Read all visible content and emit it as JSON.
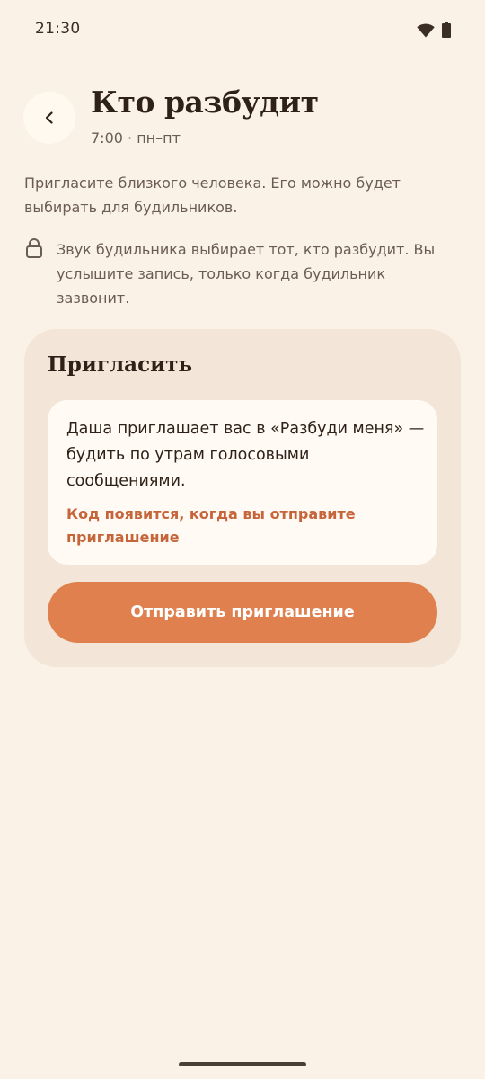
{
  "status_bar": {
    "time": "21:30",
    "icons": [
      "wifi-icon",
      "battery-icon"
    ]
  },
  "header": {
    "back_icon": "chevron-left-icon",
    "title": "Кто разбудит",
    "subtitle": "7:00 · пн–пт"
  },
  "intro": {
    "text": "Пригласите близкого человека. Его можно будет выбирать для будильников."
  },
  "privacy": {
    "icon": "lock-icon",
    "text": "Звук будильника выбирает тот, кто разбудит. Вы услышите запись, только когда будильник зазвонит."
  },
  "invite": {
    "title": "Пригласить",
    "message": "Даша приглашает вас в «Разбуди меня» — будить по утрам голосовыми сообщениями.",
    "code_hint": "Код появится, когда вы отправите приглашение",
    "send_label": "Отправить приглашение"
  },
  "colors": {
    "background": "#FAF1E7",
    "card": "#F3E6D8",
    "accent": "#E0804E",
    "accent_text": "#C6653A"
  }
}
